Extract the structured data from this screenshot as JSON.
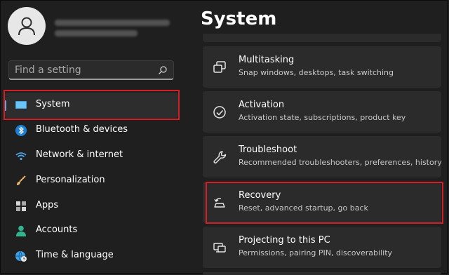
{
  "sidebar": {
    "search": {
      "placeholder": "Find a setting",
      "icon": "search-icon"
    },
    "items": [
      {
        "label": "System",
        "icon": "monitor-icon",
        "selected": true
      },
      {
        "label": "Bluetooth & devices",
        "icon": "bluetooth-icon"
      },
      {
        "label": "Network & internet",
        "icon": "wifi-icon"
      },
      {
        "label": "Personalization",
        "icon": "brush-icon"
      },
      {
        "label": "Apps",
        "icon": "apps-icon"
      },
      {
        "label": "Accounts",
        "icon": "person-icon"
      },
      {
        "label": "Time & language",
        "icon": "globe-clock-icon"
      }
    ]
  },
  "main": {
    "title": "System",
    "cards": [
      {
        "title": "Multitasking",
        "subtitle": "Snap windows, desktops, task switching",
        "icon": "multitasking-icon"
      },
      {
        "title": "Activation",
        "subtitle": "Activation state, subscriptions, product key",
        "icon": "check-circle-icon"
      },
      {
        "title": "Troubleshoot",
        "subtitle": "Recommended troubleshooters, preferences, history",
        "icon": "wrench-icon"
      },
      {
        "title": "Recovery",
        "subtitle": "Reset, advanced startup, go back",
        "icon": "recovery-icon"
      },
      {
        "title": "Projecting to this PC",
        "subtitle": "Permissions, pairing PIN, discoverability",
        "icon": "projecting-icon"
      }
    ]
  },
  "colors": {
    "background": "#1f1f1f",
    "card": "#2b2b2b",
    "accent": "#5fa9e0",
    "highlight": "#d31f25"
  }
}
